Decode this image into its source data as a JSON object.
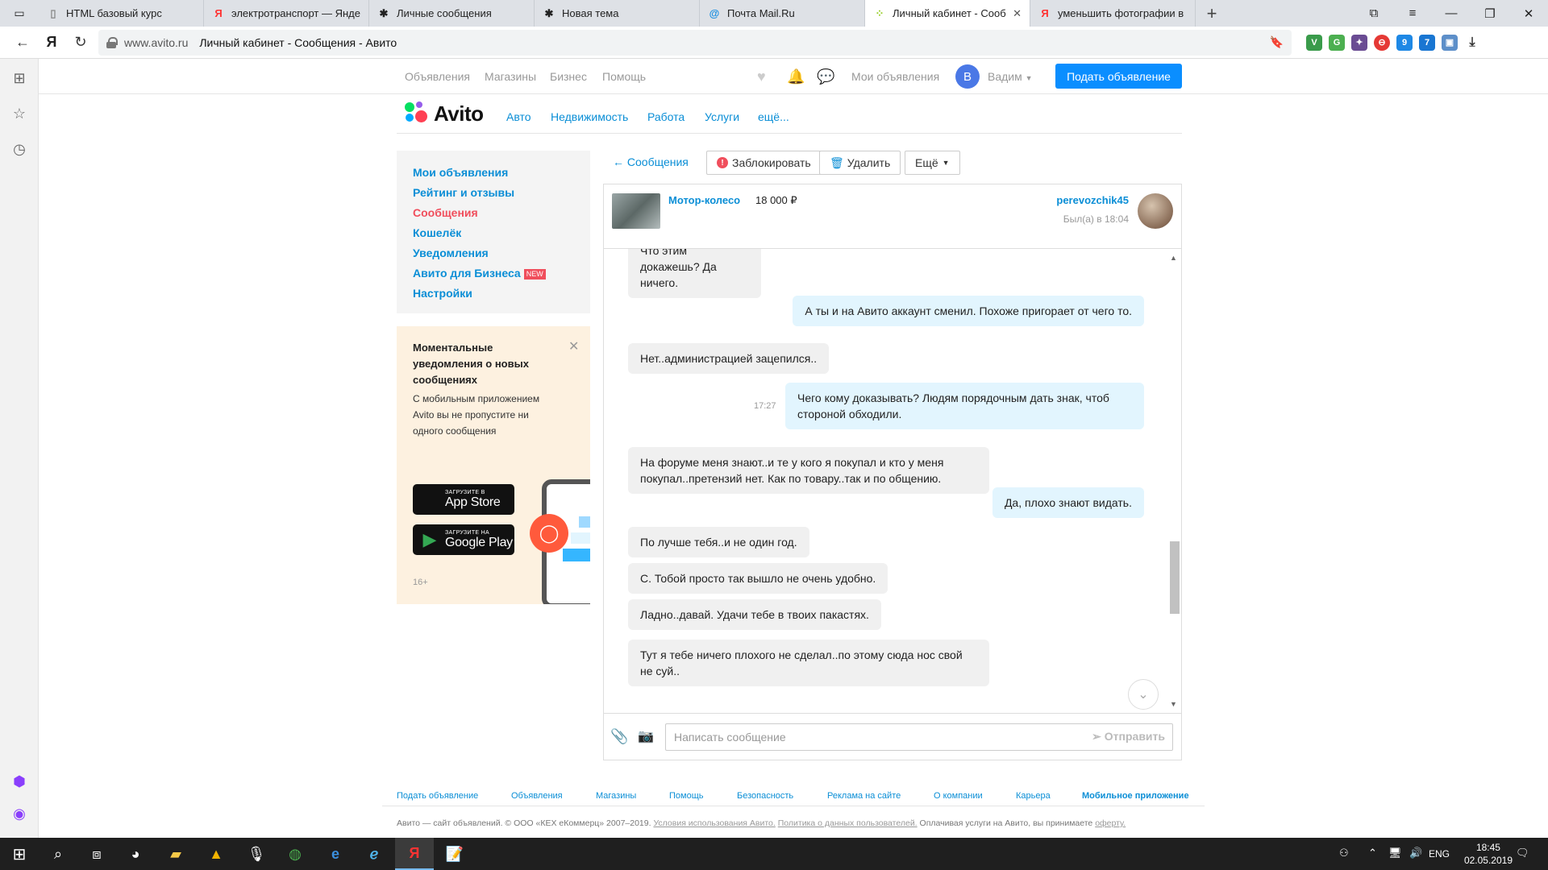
{
  "browser": {
    "tabs": [
      {
        "title": "HTML базовый курс",
        "icon": "page-icon"
      },
      {
        "title": "электротранспорт — Янде",
        "icon": "yandex-icon"
      },
      {
        "title": "Личные сообщения",
        "icon": "forum-icon"
      },
      {
        "title": "Новая тема",
        "icon": "forum-icon"
      },
      {
        "title": "Почта Mail.Ru",
        "icon": "mail-icon"
      },
      {
        "title": "Личный кабинет - Сооб",
        "icon": "avito-icon",
        "active": true
      },
      {
        "title": "уменьшить фотографии в",
        "icon": "yandex-icon"
      }
    ],
    "url_domain": "www.avito.ru",
    "page_title": "Личный кабинет - Сообщения - Авито"
  },
  "site_nav": {
    "links": [
      "Объявления",
      "Магазины",
      "Бизнес",
      "Помощь"
    ],
    "my_ads": "Мои объявления",
    "avatar_letter": "В",
    "user_name": "Вадим",
    "post_button": "Подать объявление"
  },
  "logo": {
    "text": "Avito"
  },
  "categories": [
    "Авто",
    "Недвижимость",
    "Работа",
    "Услуги",
    "ещё..."
  ],
  "sidebar": {
    "items": [
      "Мои объявления",
      "Рейтинг и отзывы",
      "Сообщения",
      "Кошелёк",
      "Уведомления",
      "Авито для Бизнеса",
      "Настройки"
    ],
    "new_badge": "NEW"
  },
  "promo": {
    "title": "Моментальные уведомления о новых сообщениях",
    "text": "С мобильным приложением Avito вы не пропустите ни одного сообщения",
    "appstore_small": "Загрузите в",
    "appstore": "App Store",
    "googleplay_small": "Загрузите на",
    "googleplay": "Google Play",
    "age": "16+"
  },
  "toolbar": {
    "back": "← Сообщения",
    "block": "Заблокировать",
    "delete": "Удалить",
    "more": "Ещё"
  },
  "chat": {
    "item_title": "Мотор-колесо",
    "item_price": "18 000 ₽",
    "peer_name": "perevozchik45",
    "peer_status": "Был(а) в 18:04",
    "messages": [
      {
        "text": "Что этим докажешь? Да ничего.",
        "dir": "in"
      },
      {
        "text": "А ты и на Авито аккаунт сменил. Похоже пригорает от чего то.",
        "dir": "out"
      },
      {
        "text": "Нет..администрацией зацепился..",
        "dir": "in"
      },
      {
        "text": "Чего кому доказывать? Людям порядочным дать знак, чтоб стороной обходили.",
        "dir": "out",
        "time": "17:27"
      },
      {
        "text": "На форуме меня знают..и те у кого я покупал и кто у меня покупал..претензий нет. Как по товару..так и по общению.",
        "dir": "in"
      },
      {
        "text": "Да, плохо знают видать.",
        "dir": "out"
      },
      {
        "text": "По лучше тебя..и не один год.",
        "dir": "in"
      },
      {
        "text": "С. Тобой просто так вышло не очень удобно.",
        "dir": "in"
      },
      {
        "text": "Ладно..давай. Удачи тебе в твоих пакастях.",
        "dir": "in"
      },
      {
        "text": "Тут я тебе ничего плохого не сделал..по этому сюда нос свой не суй..",
        "dir": "in"
      }
    ],
    "input_placeholder": "Написать сообщение",
    "send": "Отправить"
  },
  "footer": {
    "links": [
      "Подать объявление",
      "Объявления",
      "Магазины",
      "Помощь",
      "Безопасность",
      "Реклама на сайте",
      "О компании",
      "Карьера",
      "Мобильное приложение"
    ],
    "copyright": "Авито — сайт объявлений. © ООО «КЕХ eКоммерц» 2007–2019.",
    "terms": "Условия использования Авито.",
    "policy": "Политика о данных пользователей.",
    "pay_text": "Оплачивая услуги на Авито, вы принимаете",
    "offer": "оферту."
  },
  "taskbar": {
    "lang": "ENG",
    "time": "18:45",
    "date": "02.05.2019"
  },
  "colors": {
    "accent": "#0a8ed6",
    "button": "#0a8eff",
    "active": "#f04e5c",
    "outgoing": "#e2f5fe",
    "incoming": "#f0f0f0"
  }
}
